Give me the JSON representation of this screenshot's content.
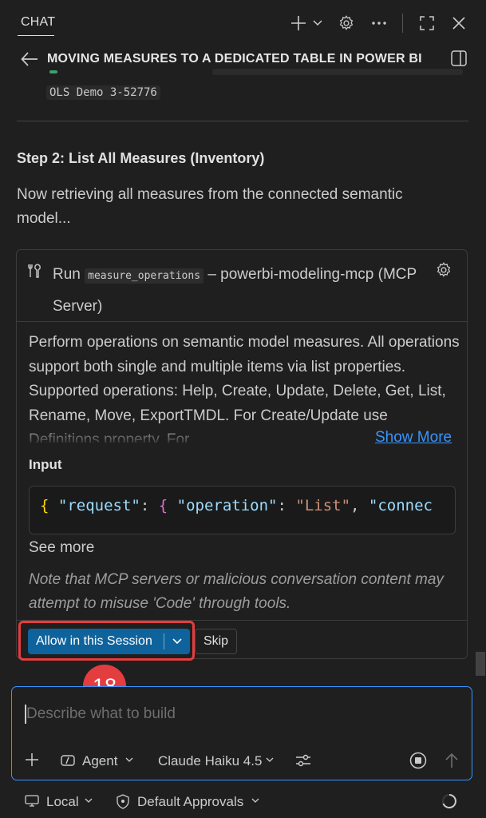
{
  "header": {
    "tab_label": "CHAT",
    "title": "MOVING MEASURES TO A DEDICATED TABLE IN POWER BI",
    "context_chip": "OLS Demo 3-52776"
  },
  "content": {
    "step_title": "Step 2: List All Measures (Inventory)",
    "step_paragraph": "Now retrieving all measures from the connected semantic model..."
  },
  "tool_card": {
    "run_word": "Run",
    "tool_name": "measure_operations",
    "server_label": "– powerbi-modeling-mcp (MCP Server)",
    "description": "Perform operations on semantic model measures. All operations support both single and multiple items via list properties. Supported operations: Help, Create, Update, Delete, Get, List, Rename, Move, ExportTMDL. For Create/Update use Definitions property. For",
    "show_more": "Show More",
    "input_label": "Input",
    "input_code": {
      "brace_open": "{",
      "key1": "\"request\"",
      "colon1": ": ",
      "brace2": "{",
      "key2": "\"operation\"",
      "colon2": ": ",
      "value2": "\"List\"",
      "comma": ", ",
      "key3": "\"connec"
    },
    "see_more": "See more",
    "note": "Note that MCP servers or malicious conversation content may attempt to misuse 'Code' through tools.",
    "allow_button": "Allow in this Session",
    "skip_button": "Skip"
  },
  "annotation": {
    "step_number": "18",
    "color": "#e43d3f"
  },
  "composer": {
    "placeholder": "Describe what to build",
    "mode_label": "Agent",
    "model_label": "Claude Haiku 4.5"
  },
  "footer": {
    "location_label": "Local",
    "approvals_label": "Default Approvals"
  },
  "colors": {
    "background": "#1f1f1f",
    "accent": "#0e639c",
    "link": "#3794ff",
    "focus_border": "#3794ff"
  }
}
